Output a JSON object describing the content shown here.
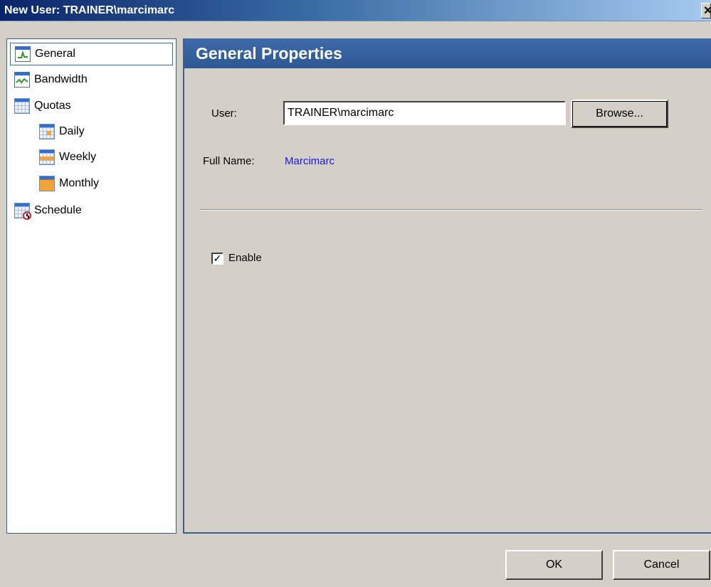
{
  "window": {
    "title": "New User: TRAINER\\marcimarc",
    "close_glyph": "✕"
  },
  "sidebar": {
    "items": [
      {
        "label": "General",
        "icon": "graph-icon",
        "selected": true
      },
      {
        "label": "Bandwidth",
        "icon": "bandwidth-graph-icon"
      },
      {
        "label": "Quotas",
        "icon": "calendar-icon"
      },
      {
        "label": "Daily",
        "icon": "calendar-day-icon"
      },
      {
        "label": "Weekly",
        "icon": "calendar-week-icon"
      },
      {
        "label": "Monthly",
        "icon": "calendar-month-icon"
      },
      {
        "label": "Schedule",
        "icon": "calendar-clock-icon"
      }
    ]
  },
  "main": {
    "header": "General Properties",
    "user_label": "User:",
    "user_value": "TRAINER\\marcimarc",
    "browse_label": "Browse...",
    "fullname_label": "Full Name:",
    "fullname_value": "Marcimarc",
    "enable_label": "Enable",
    "enable_checked": true,
    "enable_check_glyph": "✓"
  },
  "footer": {
    "ok_label": "OK",
    "cancel_label": "Cancel"
  },
  "colors": {
    "header_blue": "#2d5894",
    "link_blue": "#1818e0",
    "window_bg": "#d4d0c8"
  }
}
